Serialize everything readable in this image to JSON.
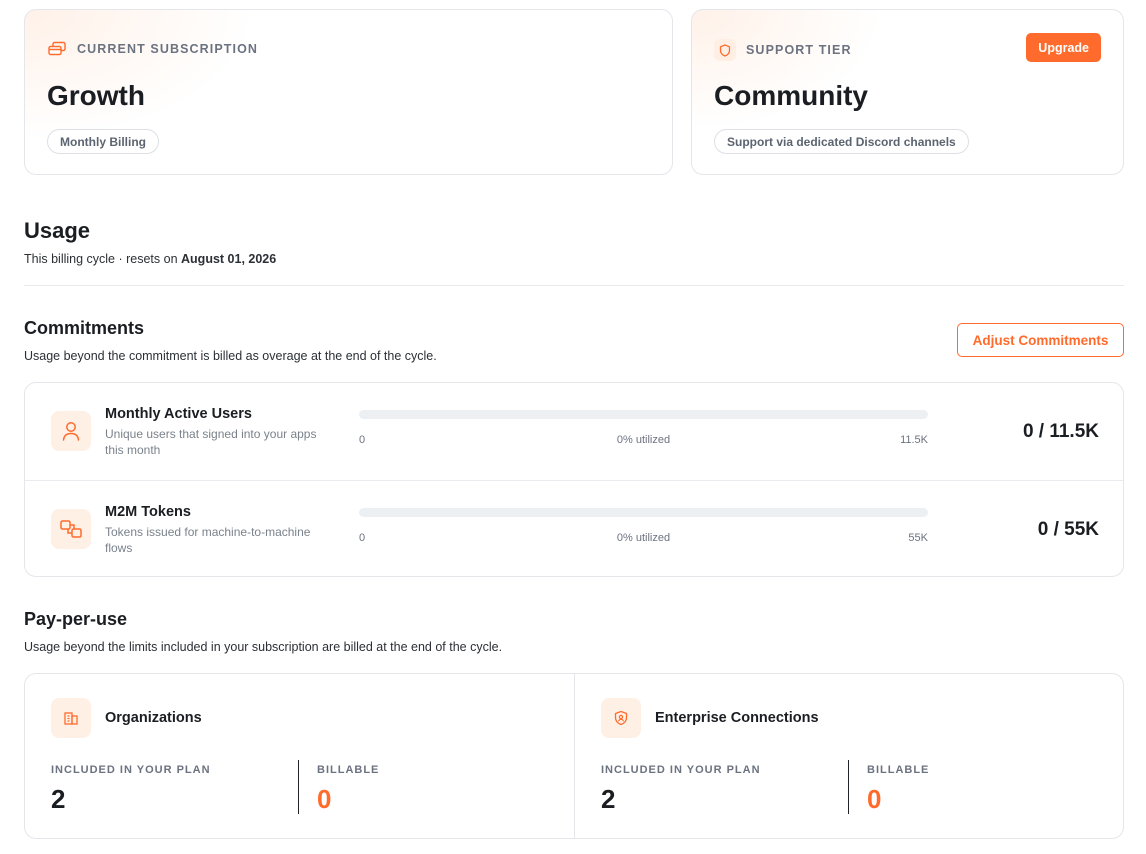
{
  "subscription": {
    "label": "CURRENT SUBSCRIPTION",
    "icon": "card-stack-icon",
    "plan": "Growth",
    "billing": "Monthly Billing"
  },
  "support": {
    "label": "SUPPORT TIER",
    "icon": "shield-icon",
    "tier": "Community",
    "description": "Support via dedicated Discord channels",
    "upgrade_label": "Upgrade"
  },
  "usage": {
    "title": "Usage",
    "cycle_prefix": "This billing cycle · resets on ",
    "reset_date": "August 01, 2026"
  },
  "commitments": {
    "title": "Commitments",
    "subtitle": "Usage beyond the commitment is billed as overage at the end of the cycle.",
    "adjust_label": "Adjust Commitments",
    "items": [
      {
        "icon": "user-icon",
        "title": "Monthly Active Users",
        "description": "Unique users that signed into your apps this month",
        "min": "0",
        "utilized": "0% utilized",
        "utilization_fraction": 0,
        "max": "11.5K",
        "value": "0 / 11.5K"
      },
      {
        "icon": "linked-squares-icon",
        "title": "M2M Tokens",
        "description": "Tokens issued for machine-to-machine flows",
        "min": "0",
        "utilized": "0% utilized",
        "utilization_fraction": 0,
        "max": "55K",
        "value": "0 / 55K"
      }
    ]
  },
  "payperuse": {
    "title": "Pay-per-use",
    "subtitle": "Usage beyond the limits included in your subscription are billed at the end of the cycle.",
    "items": [
      {
        "icon": "building-icon",
        "title": "Organizations",
        "included_label": "INCLUDED IN YOUR PLAN",
        "included_value": "2",
        "billable_label": "BILLABLE",
        "billable_value": "0"
      },
      {
        "icon": "shield-user-icon",
        "title": "Enterprise Connections",
        "included_label": "INCLUDED IN YOUR PLAN",
        "included_value": "2",
        "billable_label": "BILLABLE",
        "billable_value": "0"
      }
    ]
  },
  "colors": {
    "accent": "#ff6b2c",
    "accent_soft": "#fff0e6",
    "border": "#e4e6ea"
  }
}
